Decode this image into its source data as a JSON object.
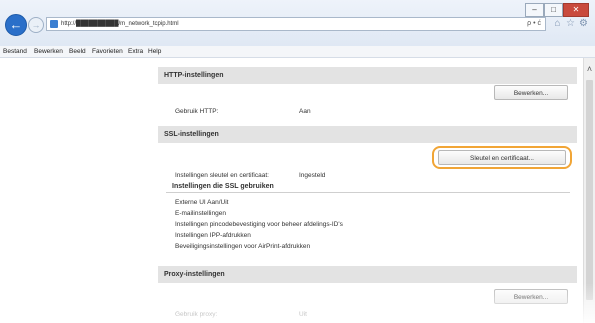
{
  "browser": {
    "address": "http://██████████/m_network_tcpip.html",
    "address_tools": "ρ • ć",
    "window_controls": {
      "minimize": "–",
      "maximize": "□",
      "close": "✕"
    },
    "icons": [
      "home-icon",
      "favorites-star-icon",
      "settings-gear-icon"
    ]
  },
  "menu": [
    "Bestand",
    "Bewerken",
    "Beeld",
    "Favorieten",
    "Extra",
    "Help"
  ],
  "http_section": {
    "title": "HTTP-instellingen",
    "edit_button": "Bewerken...",
    "use_http_label": "Gebruik HTTP:",
    "use_http_value": "Aan"
  },
  "ssl_section": {
    "title": "SSL-instellingen",
    "key_cert_button": "Sleutel en certificaat...",
    "key_cert_label": "Instellingen sleutel en certificaat:",
    "key_cert_value": "Ingesteld",
    "usage_heading": "Instellingen die SSL gebruiken",
    "usage_items": [
      "Externe UI Aan/Uit",
      "E-mailinstellingen",
      "Instellingen pincodebevestiging voor beheer afdelings-ID's",
      "Instellingen IPP-afdrukken",
      "Beveiligingsinstellingen voor AirPrint-afdrukken"
    ]
  },
  "proxy_section": {
    "title": "Proxy-instellingen",
    "edit_button": "Bewerken...",
    "use_proxy_label": "Gebruik proxy:",
    "use_proxy_value": "Uit"
  }
}
